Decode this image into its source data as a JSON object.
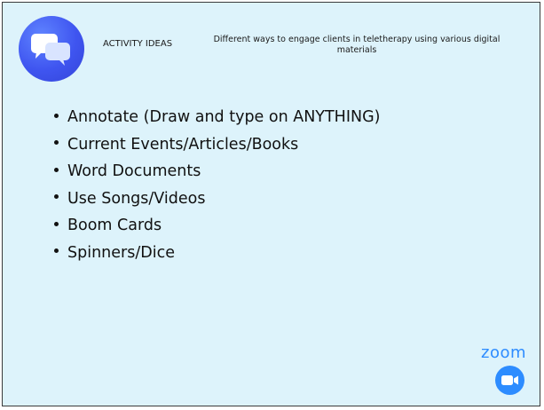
{
  "header": {
    "label": "ACTIVITY IDEAS",
    "description": "Different ways to engage clients in teletherapy using various digital materials"
  },
  "bullets": [
    "Annotate (Draw and type on ANYTHING)",
    "Current Events/Articles/Books",
    "Word Documents",
    "Use Songs/Videos",
    "Boom Cards",
    "Spinners/Dice"
  ],
  "brand": {
    "name": "zoom",
    "color": "#2d8cff",
    "icon": "zoom-camera-icon"
  },
  "logo": {
    "icon": "chat-bubbles-icon",
    "color": "#3f55f0"
  },
  "colors": {
    "background": "#ddf3fb",
    "border": "#3b3b3b"
  }
}
